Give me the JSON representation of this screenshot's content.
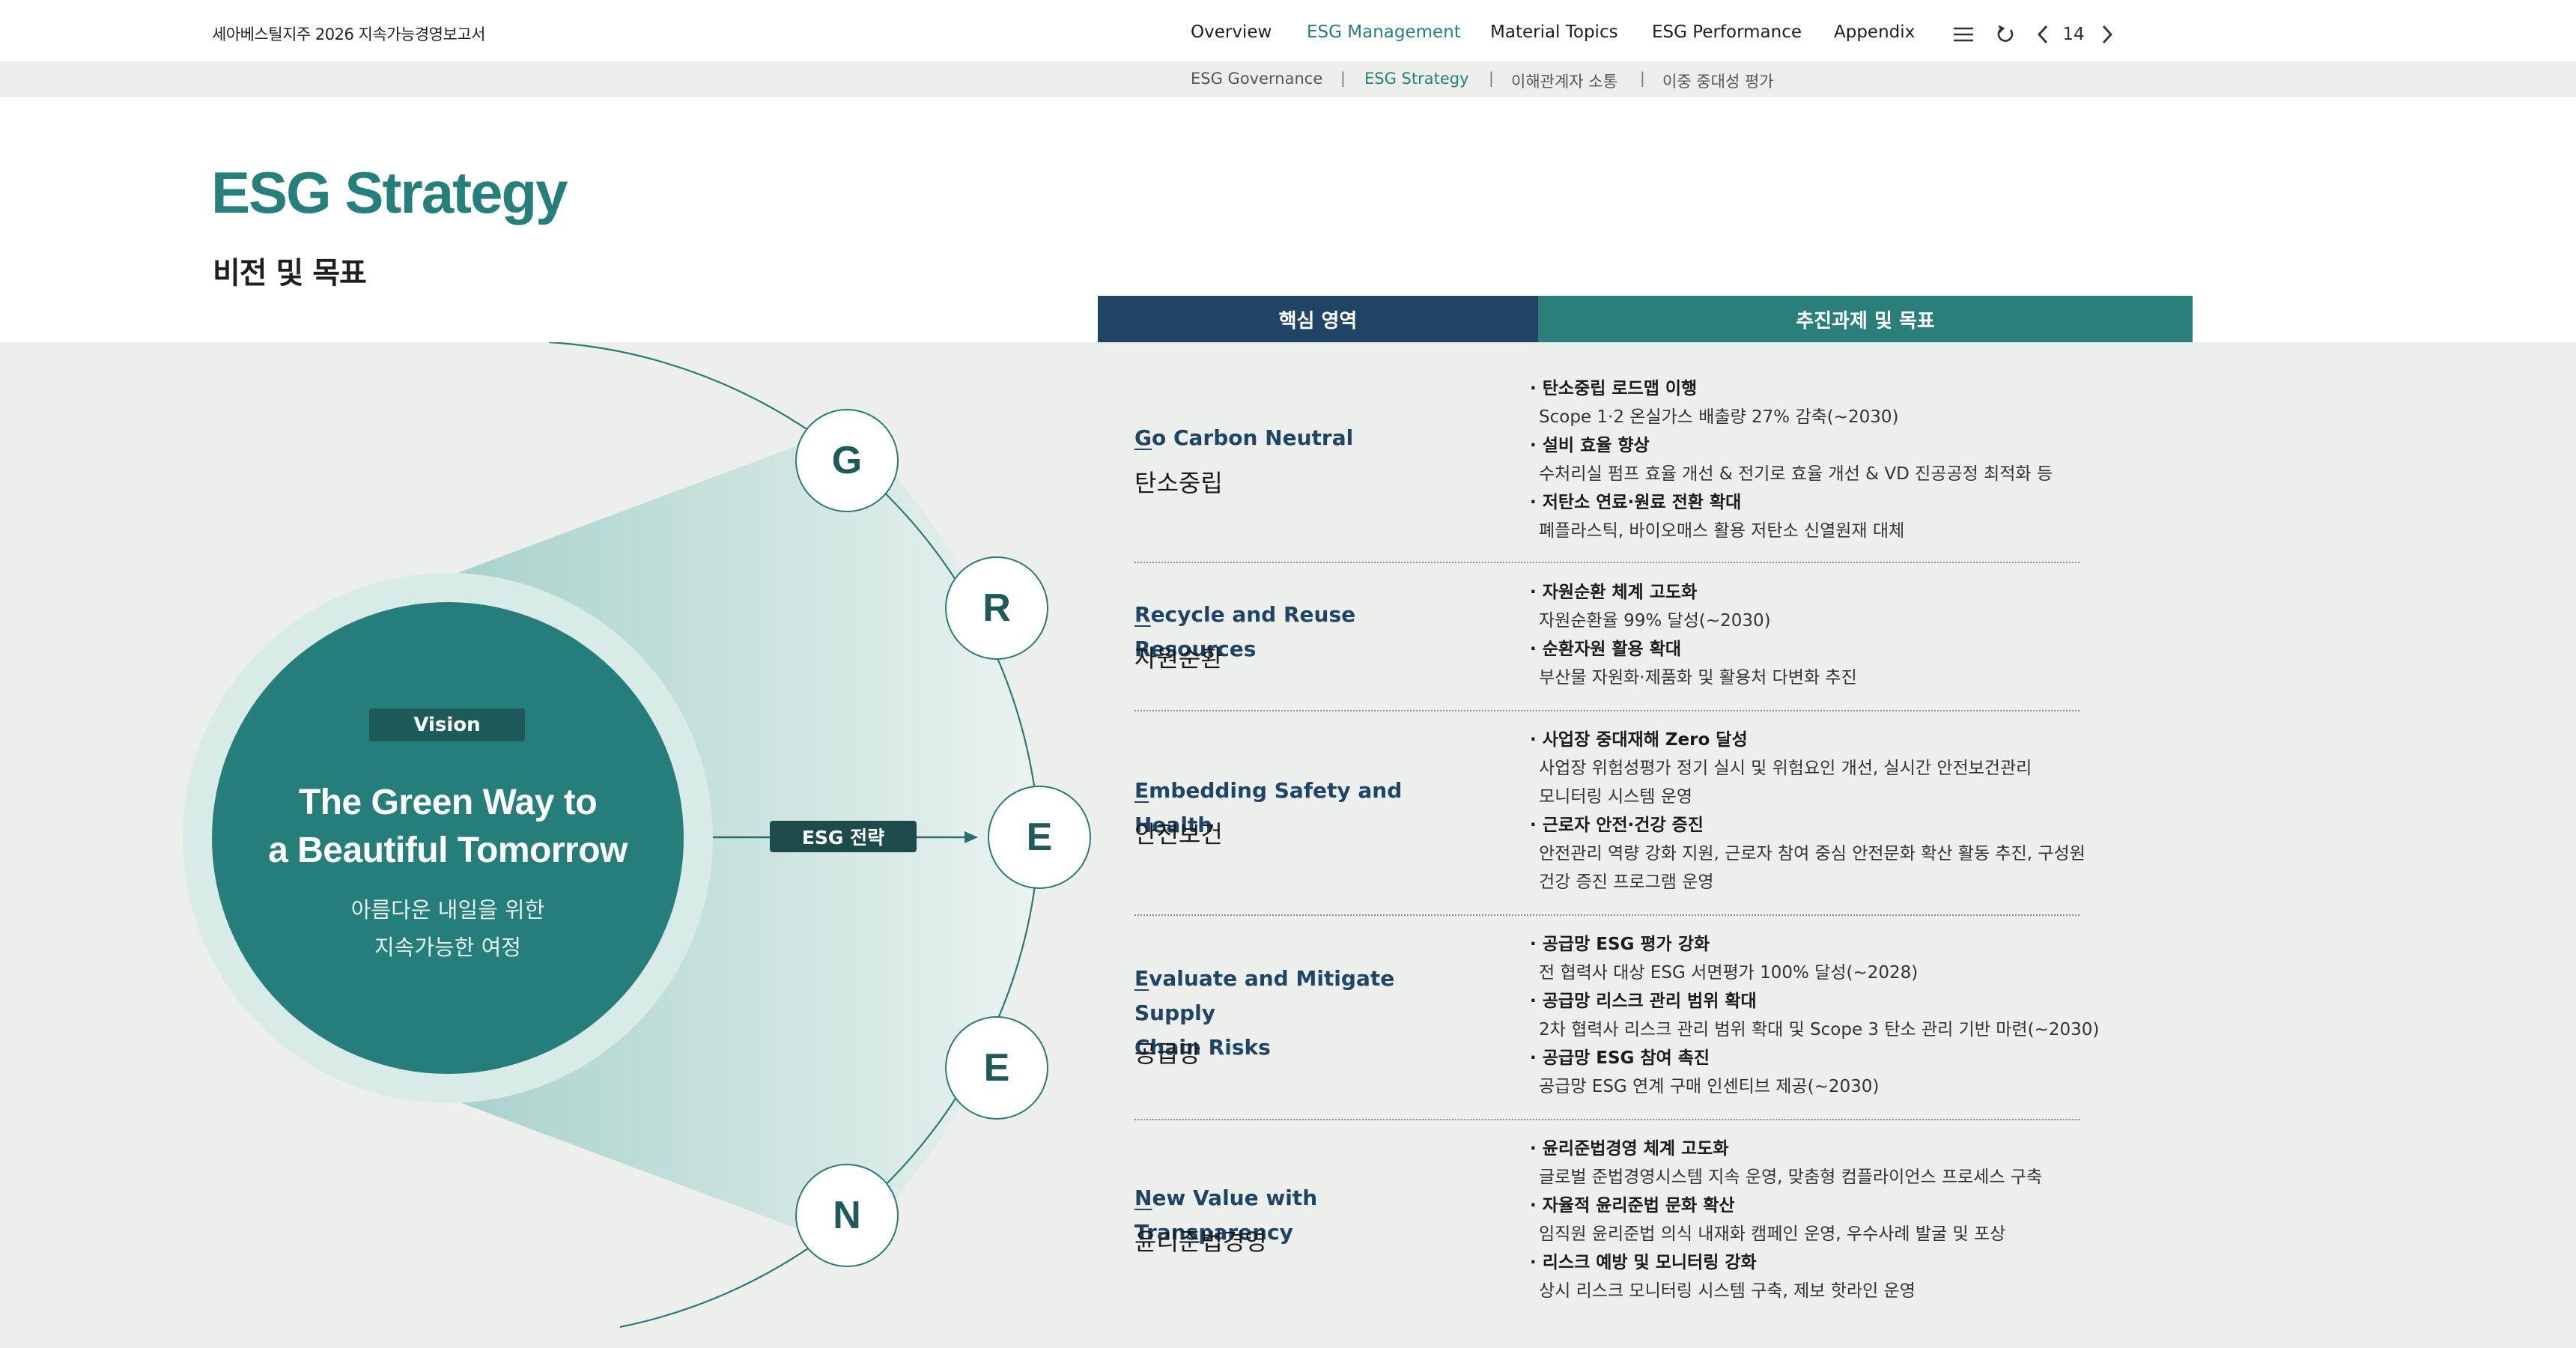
{
  "header": {
    "report_title": "세아베스틸지주 2026 지속가능경영보고서",
    "nav": [
      "Overview",
      "ESG Management",
      "Material Topics",
      "ESG Performance",
      "Appendix"
    ],
    "active_nav": "ESG Management",
    "page_number": "14",
    "icons": [
      "menu-icon",
      "refresh-icon",
      "prev-icon",
      "next-icon"
    ]
  },
  "subnav": {
    "items": [
      "ESG Governance",
      "ESG Strategy",
      "이해관계자 소통",
      "이중 중대성 평가"
    ],
    "separator": "|",
    "active": "ESG Strategy"
  },
  "page": {
    "title": "ESG Strategy",
    "subtitle": "비전 및 목표"
  },
  "columns": {
    "core": "핵심 영역",
    "tasks": "추진과제 및 목표"
  },
  "vision": {
    "tag": "Vision",
    "line1": "The Green Way to",
    "line2": "a Beautiful Tomorrow",
    "kr1": "아름다운 내일을 위한",
    "kr2": "지속가능한 여정",
    "esg_tag": "ESG 전략"
  },
  "letters": [
    "G",
    "R",
    "E",
    "E",
    "N"
  ],
  "rows": [
    {
      "first": "G",
      "en_lines": [
        "o Carbon Neutral"
      ],
      "kr": "탄소중립",
      "tasks": [
        {
          "title": "· 탄소중립 로드맵 이행",
          "desc": [
            "Scope 1·2  온실가스 배출량 27% 감축(~2030)"
          ]
        },
        {
          "title": "· 설비 효율 향상",
          "desc": [
            "수처리실 펌프 효율 개선 & 전기로 효율 개선 & VD 진공공정 최적화 등"
          ]
        },
        {
          "title": "· 저탄소 연료·원료 전환 확대",
          "desc": [
            "폐플라스틱, 바이오매스 활용 저탄소 신열원재 대체"
          ]
        }
      ]
    },
    {
      "first": "R",
      "en_lines": [
        "ecycle and Reuse Resources"
      ],
      "kr": "자원순환",
      "tasks": [
        {
          "title": "· 자원순환 체계 고도화",
          "desc": [
            "자원순환율 99% 달성(~2030)"
          ]
        },
        {
          "title": "· 순환자원 활용 확대",
          "desc": [
            "부산물 자원화·제품화 및 활용처 다변화 추진"
          ]
        }
      ]
    },
    {
      "first": "E",
      "en_lines": [
        "mbedding Safety and Health"
      ],
      "kr": "안전보건",
      "tasks": [
        {
          "title": "· 사업장 중대재해 Zero 달성",
          "desc": [
            "사업장 위험성평가 정기 실시 및 위험요인 개선, 실시간 안전보건관리",
            "모니터링 시스템 운영"
          ]
        },
        {
          "title": "· 근로자 안전·건강 증진",
          "desc": [
            "안전관리 역량 강화 지원, 근로자 참여 중심 안전문화 확산 활동 추진, 구성원",
            "건강 증진 프로그램 운영"
          ]
        }
      ]
    },
    {
      "first": "E",
      "en_lines": [
        "valuate and Mitigate Supply",
        "Chain Risks"
      ],
      "kr": "공급망",
      "tasks": [
        {
          "title": "· 공급망 ESG 평가 강화",
          "desc": [
            "전 협력사 대상 ESG 서면평가 100% 달성(~2028)"
          ]
        },
        {
          "title": "· 공급망 리스크 관리 범위 확대",
          "desc": [
            "2차 협력사 리스크 관리 범위 확대 및 Scope 3 탄소 관리 기반 마련(~2030)"
          ]
        },
        {
          "title": "· 공급망 ESG 참여 촉진",
          "desc": [
            "공급망 ESG 연계 구매 인센티브 제공(~2030)"
          ]
        }
      ]
    },
    {
      "first": "N",
      "en_lines": [
        "ew Value with Transparency"
      ],
      "kr": "윤리준법경영",
      "tasks": [
        {
          "title": "· 윤리준법경영 체계 고도화",
          "desc": [
            "글로벌 준법경영시스템 지속 운영, 맞춤형 컴플라이언스 프로세스 구축"
          ]
        },
        {
          "title": "· 자율적 윤리준법 문화 확산",
          "desc": [
            "임직원 윤리준법 의식 내재화 캠페인 운영, 우수사례 발굴 및 포상"
          ]
        },
        {
          "title": "· 리스크 예방 및 모니터링 강화",
          "desc": [
            "상시 리스크 모니터링 시스템 구축, 제보 핫라인 운영"
          ]
        }
      ]
    }
  ],
  "colors": {
    "teal": "#267e7a",
    "navy": "#1f4466",
    "band": "#ecefec"
  }
}
